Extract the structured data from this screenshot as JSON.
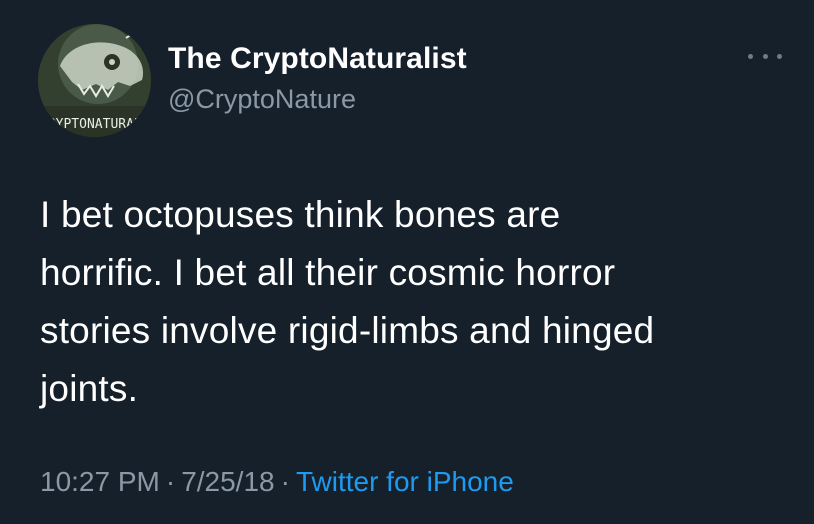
{
  "author": {
    "display_name": "The CryptoNaturalist",
    "handle": "@CryptoNature",
    "avatar_text": "CRYPTONATURALIST",
    "avatar_icon": "skull-avatar-icon"
  },
  "tweet": {
    "text_lines": [
      "I bet octopuses think bones are",
      "horrific. I bet all their cosmic horror",
      "stories involve rigid-limbs and hinged",
      "joints."
    ],
    "time": "10:27 PM",
    "separator": "·",
    "date": "7/25/18",
    "source": "Twitter for iPhone"
  },
  "menu": {
    "icon": "more-options-icon"
  },
  "colors": {
    "background": "#15202b",
    "text_primary": "#ffffff",
    "text_secondary": "#8b98a5",
    "accent": "#1d9bf0"
  }
}
